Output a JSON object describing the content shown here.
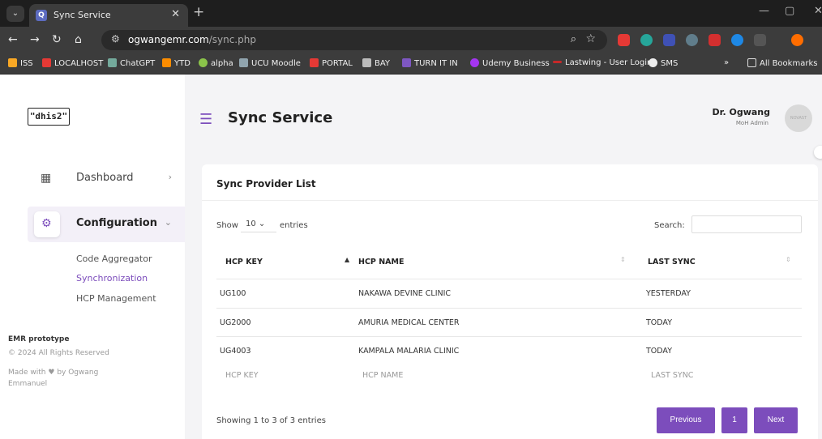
{
  "browser": {
    "tab_title": "Sync Service",
    "tab_favicon": "Q",
    "url_host": "ogwangemr.com",
    "url_path": "/sync.php",
    "bookmarks": [
      "ISS",
      "LOCALHOST",
      "ChatGPT",
      "YTD",
      "alpha",
      "UCU Moodle",
      "PORTAL",
      "BAY",
      "TURN IT IN",
      "Udemy Business",
      "Lastwing - User Login",
      "SMS",
      "All Bookmarks"
    ]
  },
  "sidebar": {
    "logo": "\"dhis2\"",
    "items": [
      {
        "label": "Dashboard",
        "icon": "dashboard-icon"
      },
      {
        "label": "Configuration",
        "icon": "gear-icon"
      }
    ],
    "subitems": [
      "Code Aggregator",
      "Synchronization",
      "HCP Management"
    ],
    "footer_title": "EMR prototype",
    "footer_copy": "© 2024 All Rights Reserved",
    "footer_made_prefix": "Made with",
    "footer_made_suffix": "by Ogwang Emmanuel"
  },
  "header": {
    "title": "Sync Service",
    "user_name": "Dr. Ogwang",
    "user_role": "MoH Admin",
    "avatar_text": "NOVAST"
  },
  "card": {
    "title": "Sync Provider List",
    "show_label": "Show",
    "entries_value": "10",
    "entries_label": "entries",
    "search_label": "Search:",
    "columns": [
      "HCP KEY",
      "HCP NAME",
      "LAST SYNC"
    ],
    "rows": [
      [
        "UG100",
        "NAKAWA DEVINE CLINIC",
        "YESTERDAY"
      ],
      [
        "UG2000",
        "AMURIA MEDICAL CENTER",
        "TODAY"
      ],
      [
        "UG4003",
        "KAMPALA MALARIA CLINIC",
        "TODAY"
      ]
    ],
    "info": "Showing 1 to 3 of 3 entries",
    "pagination": {
      "previous": "Previous",
      "page": "1",
      "next": "Next"
    }
  },
  "colors": {
    "accent": "#7c4dbc"
  }
}
